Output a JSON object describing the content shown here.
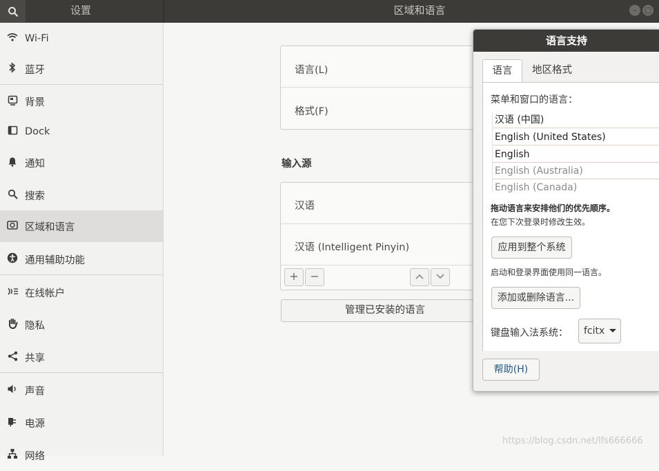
{
  "header": {
    "app_title": "设置",
    "page_title": "区域和语言",
    "search_icon": "search-icon"
  },
  "sidebar": {
    "items": [
      {
        "label": "Wi-Fi",
        "icon": "wifi-icon"
      },
      {
        "label": "蓝牙",
        "icon": "bluetooth-icon"
      },
      {
        "label": "背景",
        "icon": "background-icon"
      },
      {
        "label": "Dock",
        "icon": "dock-icon"
      },
      {
        "label": "通知",
        "icon": "bell-icon"
      },
      {
        "label": "搜索",
        "icon": "search-icon"
      },
      {
        "label": "区域和语言",
        "icon": "region-icon"
      },
      {
        "label": "通用辅助功能",
        "icon": "accessibility-icon"
      },
      {
        "label": "在线帐户",
        "icon": "online-accounts-icon"
      },
      {
        "label": "隐私",
        "icon": "hand-icon"
      },
      {
        "label": "共享",
        "icon": "share-icon"
      },
      {
        "label": "声音",
        "icon": "speaker-icon"
      },
      {
        "label": "电源",
        "icon": "power-icon"
      },
      {
        "label": "网络",
        "icon": "network-icon"
      }
    ],
    "active": "区域和语言"
  },
  "main": {
    "language_label": "语言(L)",
    "format_label": "格式(F)",
    "input_sources_title": "输入源",
    "input_sources": [
      "汉语",
      "汉语 (Intelligent Pinyin)"
    ],
    "add_symbol": "+",
    "remove_symbol": "−",
    "manage_button": "管理已安装的语言"
  },
  "dialog": {
    "title": "语言支持",
    "tabs": [
      "语言",
      "地区格式"
    ],
    "menu_language_label": "菜单和窗口的语言：",
    "languages": [
      "汉语 (中国)",
      "English (United States)",
      "English",
      "English (Australia)",
      "English (Canada)"
    ],
    "drag_hint": "拖动语言来安排他们的优先顺序。",
    "effect_hint": "在您下次登录时修改生效。",
    "apply_button": "应用到整个系统",
    "login_hint": "启动和登录界面使用同一语言。",
    "add_remove_button": "添加或删除语言...",
    "keyboard_label": "键盘输入法系统：",
    "keyboard_value": "fcitx",
    "help_button": "帮助(H)"
  },
  "watermark": "https://blog.csdn.net/lfs666666"
}
